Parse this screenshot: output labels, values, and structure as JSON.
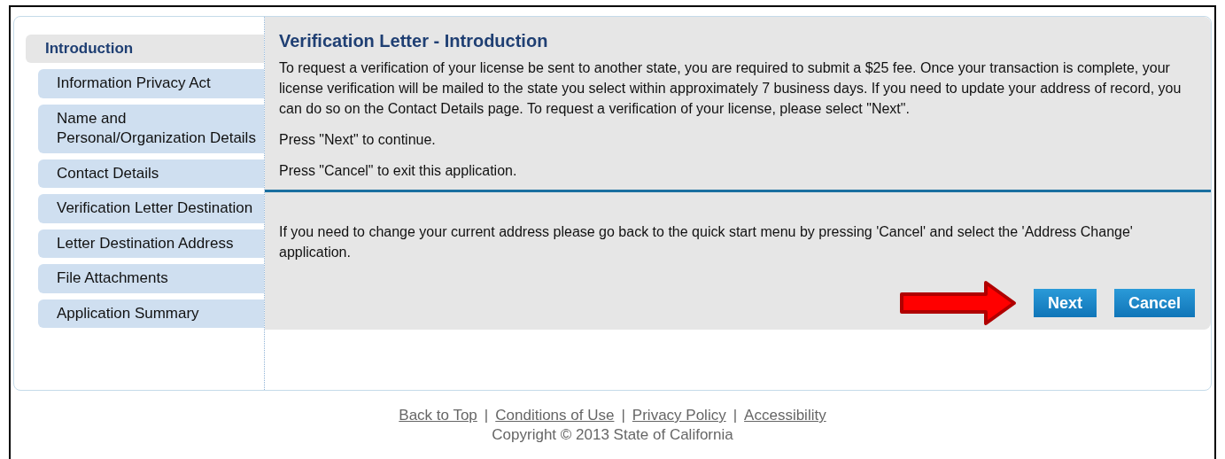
{
  "sidebar": {
    "items": [
      {
        "label": "Introduction",
        "selected": true
      },
      {
        "label": "Information Privacy Act",
        "selected": false
      },
      {
        "label": "Name and Personal/Organization Details",
        "selected": false
      },
      {
        "label": "Contact Details",
        "selected": false
      },
      {
        "label": "Verification Letter Destination",
        "selected": false
      },
      {
        "label": "Letter Destination Address",
        "selected": false
      },
      {
        "label": "File Attachments",
        "selected": false
      },
      {
        "label": "Application Summary",
        "selected": false
      }
    ]
  },
  "content": {
    "title": "Verification Letter - Introduction",
    "paragraphs": [
      "To request a verification of your license be sent to another state, you are required to submit a $25 fee. Once your transaction is complete, your license verification will be mailed to the state you select within approximately 7 business days. If you need to update your address of record, you can do so on the Contact Details page. To request a verification of your license, please select \"Next\".",
      "Press \"Next\" to continue.",
      "Press \"Cancel\" to exit this application."
    ],
    "note": "If you need to change your current address please go back to the quick start menu by pressing 'Cancel' and select the 'Address Change' application.",
    "buttons": [
      "Next",
      "Cancel"
    ]
  },
  "footer": {
    "items": [
      {
        "kind": "link",
        "text": "Back to Top"
      },
      {
        "kind": "separator",
        "text": "|"
      },
      {
        "kind": "link",
        "text": "Conditions of Use"
      },
      {
        "kind": "separator",
        "text": "|"
      },
      {
        "kind": "link",
        "text": "Privacy Policy"
      },
      {
        "kind": "separator",
        "text": "|"
      },
      {
        "kind": "link",
        "text": "Accessibility"
      }
    ],
    "copyright": "Copyright © 2013 State of California"
  }
}
